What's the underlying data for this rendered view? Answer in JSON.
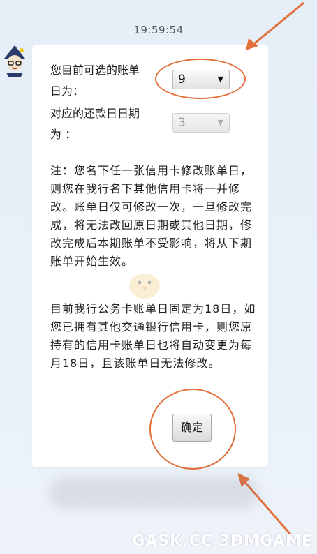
{
  "timestamp": "19:59:54",
  "form": {
    "statement_day_label": "您目前可选的账单日为：",
    "statement_day_label_line1": "您目前可选的账单",
    "statement_day_label_line2": "日为：",
    "statement_day_value": "9",
    "repayment_day_label_line1": "对应的还款日日期",
    "repayment_day_label_line2": "为 ：",
    "repayment_day_value": "3"
  },
  "notice": {
    "paragraph1": "注：您名下任一张信用卡修改账单日，则您在我行名下其他信用卡将一并修改。账单日仅可修改一次，一旦修改完成，将无法改回原日期或其他日期，修改完成后本期账单不受影响，将从下期账单开始生效。",
    "paragraph2": "目前我行公务卡账单日固定为18日，如您已拥有其他交通银行信用卡，则您原持有的信用卡账单日也将自动变更为每月18日，且该账单日无法修改。"
  },
  "confirm_label": "确定",
  "watermark": "GASK.CC 3DMGAME",
  "colors": {
    "annotation": "#e2713c",
    "background": "#e6eef8",
    "bubble": "#ffffff"
  },
  "icons": {
    "avatar": "bank-assistant-avatar",
    "dropdown": "triangle-down-icon",
    "arrow": "annotation-arrow"
  }
}
